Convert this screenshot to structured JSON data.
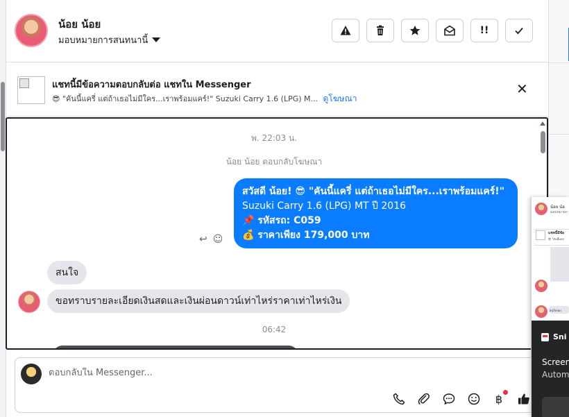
{
  "header": {
    "contact_name": "น้อย น้อย",
    "assign_label": "มอบหมายการสนทนานี้",
    "actions": [
      {
        "icon": "alert-triangle-icon",
        "label": ""
      },
      {
        "icon": "trash-icon",
        "label": ""
      },
      {
        "icon": "star-icon",
        "label": ""
      },
      {
        "icon": "mail-open-icon",
        "label": ""
      },
      {
        "icon": "follow-up-icon",
        "label": "!!"
      },
      {
        "icon": "check-icon",
        "label": ""
      }
    ]
  },
  "banner": {
    "title": "แชทนี้มีข้อความตอบกลับต่อ แชทใน Messenger",
    "subtitle": "😎 \"คันนี้แครี่ แต่ถ้าเธอไม่มีใคร...เราพร้อมแคร์!\" Suzuki Carry 1.6 (LPG) M...",
    "link": "ดูโฆษณา",
    "close": "✕"
  },
  "chat": {
    "timestamp_1": "พ. 22:03 น.",
    "ad_reply_note": "น้อย น้อย ตอบกลับโฆษณา",
    "outgoing": {
      "line1": "สวัสดี น้อย! 😎 \"คันนี้แครี่ แต่ถ้าเธอไม่มีใคร...เราพร้อมแคร์!\"",
      "line2": "Suzuki Carry 1.6 (LPG) MT ปี 2016",
      "line3": "📌 รหัสรถ: C059",
      "line4": "💰 ราคาเพียง 179,000 บาท"
    },
    "reply_icon": "↩",
    "react_icon": "☺",
    "incoming_1": "สนใจ",
    "incoming_2": "ขอทราบรายละเอียดเงินสดและเงินผ่อนดาวน์เท่าไหร่ราคาเท่าไหร่เงิน",
    "timestamp_2": "06:42"
  },
  "composer": {
    "placeholder": "ตอบกลับใน Messenger...",
    "tools": [
      "phone-icon",
      "paperclip-icon",
      "chat-bubble-icon",
      "emoji-icon",
      "baht-icon",
      "thumbs-up-icon"
    ],
    "baht": "฿"
  },
  "overlay": {
    "name": "น้อย น้อ",
    "sub": "มอบหมายก",
    "banner_title": "แชทนี้มีข้อ",
    "banner_sub": "😎 \"คันนี้แคร",
    "bubble": "สนใจรอบ",
    "dark_title": "Sni",
    "dark_line1": "Screen",
    "dark_line2": "Autom"
  },
  "colors": {
    "outgoing_bubble": "#0a7cff",
    "incoming_bubble": "#e4e6eb",
    "link": "#1877f2"
  }
}
